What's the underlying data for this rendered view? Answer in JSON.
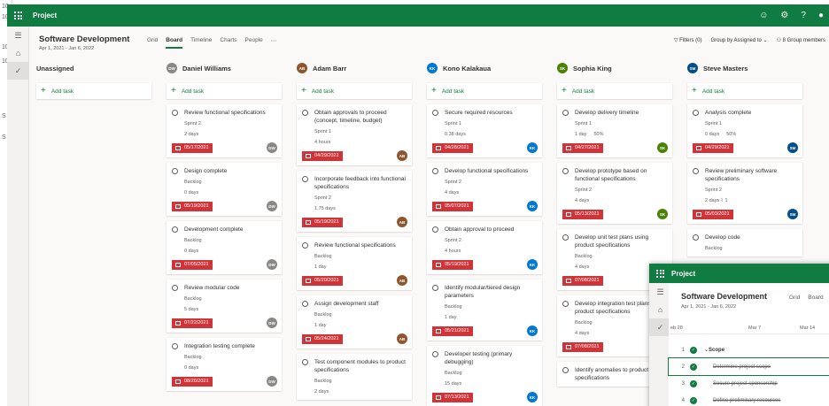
{
  "background": {
    "edge_numbers": [
      "10",
      "10",
      "10",
      "10",
      "S",
      "S"
    ]
  },
  "app": {
    "title": "Project",
    "icons": [
      "smiley-icon",
      "gear-icon",
      "help-icon",
      "avatar-icon"
    ]
  },
  "project": {
    "title": "Software Development",
    "dates": "Apr 1, 2021 - Jan 6, 2022"
  },
  "tabs": [
    "Grid",
    "Board",
    "Timeline",
    "Charts",
    "People"
  ],
  "active_tab": "Board",
  "toolbar": {
    "filters": "Filters (0)",
    "group_by": "Group by Assigned to",
    "members": "8 Group members"
  },
  "add_task_label": "Add task",
  "columns": [
    {
      "name": "Unassigned",
      "initials": "",
      "color": "",
      "cards": []
    },
    {
      "name": "Daniel Williams",
      "initials": "DW",
      "color": "#8a8886",
      "cards": [
        {
          "title": "Review functional specifications",
          "sprint": "Sprint 2",
          "duration": "2 days",
          "due": "05/17/2021"
        },
        {
          "title": "Design complete",
          "sprint": "Backlog",
          "duration": "0 days",
          "due": "05/19/2021"
        },
        {
          "title": "Development complete",
          "sprint": "Backlog",
          "duration": "0 days",
          "due": "07/05/2021"
        },
        {
          "title": "Review modular code",
          "sprint": "Backlog",
          "duration": "5 days",
          "due": "07/22/2021"
        },
        {
          "title": "Integration testing complete",
          "sprint": "Backlog",
          "duration": "0 days",
          "due": "08/26/2021"
        }
      ]
    },
    {
      "name": "Adam Barr",
      "initials": "AB",
      "color": "#8e562e",
      "cards": [
        {
          "title": "Obtain approvals to proceed (concept, timeline, budget)",
          "sprint": "Sprint 1",
          "duration": "4 hours",
          "due": "04/29/2021"
        },
        {
          "title": "Incorporate feedback into functional specifications",
          "sprint": "Sprint 2",
          "duration": "1.75 days",
          "due": "05/19/2021"
        },
        {
          "title": "Review functional specifications",
          "sprint": "Backlog",
          "duration": "1 day",
          "due": "05/20/2021"
        },
        {
          "title": "Assign development staff",
          "sprint": "Backlog",
          "duration": "1 day",
          "due": "05/24/2021"
        },
        {
          "title": "Test component modules to product specifications",
          "sprint": "Backlog",
          "duration": "2 days",
          "due": ""
        }
      ]
    },
    {
      "name": "Kono Kalakaua",
      "initials": "KK",
      "color": "#0078d4",
      "cards": [
        {
          "title": "Secure required resources",
          "sprint": "Sprint 1",
          "duration": "0.38 days",
          "due": "04/28/2021"
        },
        {
          "title": "Develop functional specifications",
          "sprint": "Sprint 2",
          "duration": "4 days",
          "due": "05/07/2021"
        },
        {
          "title": "Obtain approval to proceed",
          "sprint": "Sprint 2",
          "duration": "4 hours",
          "due": "05/19/2021"
        },
        {
          "title": "Identify modular/tiered design parameters",
          "sprint": "Backlog",
          "duration": "1 day",
          "due": "05/21/2021"
        },
        {
          "title": "Developer testing (primary debugging)",
          "sprint": "Backlog",
          "duration": "15 days",
          "due": "07/13/2021"
        }
      ]
    },
    {
      "name": "Sophia King",
      "initials": "SK",
      "color": "#498205",
      "cards": [
        {
          "title": "Develop delivery timeline",
          "sprint": "Sprint 1",
          "duration": "1 day",
          "progress": "50%",
          "due": "04/27/2021"
        },
        {
          "title": "Develop prototype based on functional specifications",
          "sprint": "Sprint 2",
          "duration": "4 days",
          "due": "05/13/2021"
        },
        {
          "title": "Develop unit test plans using product specifications",
          "sprint": "Backlog",
          "duration": "4 days",
          "due": "07/08/2021"
        },
        {
          "title": "Develop integration test plans using product specifications",
          "sprint": "Backlog",
          "duration": "4 days",
          "due": "07/08/2021"
        },
        {
          "title": "Identify anomalies to product specifications",
          "sprint": "",
          "duration": "",
          "due": ""
        }
      ]
    },
    {
      "name": "Steve Masters",
      "initials": "SM",
      "color": "#004e8c",
      "cards": [
        {
          "title": "Analysis complete",
          "sprint": "Sprint 1",
          "duration": "0 days",
          "progress": "50%",
          "due": "04/29/2021"
        },
        {
          "title": "Review preliminary software specifications",
          "sprint": "Sprint 2",
          "duration": "2 days",
          "attachments": "1",
          "due": "05/03/2021"
        },
        {
          "title": "Develop code",
          "sprint": "Backlog",
          "duration": "",
          "due": ""
        }
      ]
    }
  ],
  "overlay": {
    "app_title": "Project",
    "project_title": "Software Development",
    "dates": "Apr 1, 2021 - Jan 6, 2022",
    "tabs": [
      "Grid",
      "Board"
    ],
    "timeline": [
      "eb 28",
      "Mar 7",
      "Mar 14"
    ],
    "rows": [
      {
        "num": "1",
        "name": "Scope",
        "summary": true
      },
      {
        "num": "2",
        "name": "Determine project scope",
        "summary": false
      },
      {
        "num": "3",
        "name": "Secure project sponsorship",
        "summary": false
      },
      {
        "num": "4",
        "name": "Define preliminary resources",
        "summary": false
      }
    ]
  }
}
